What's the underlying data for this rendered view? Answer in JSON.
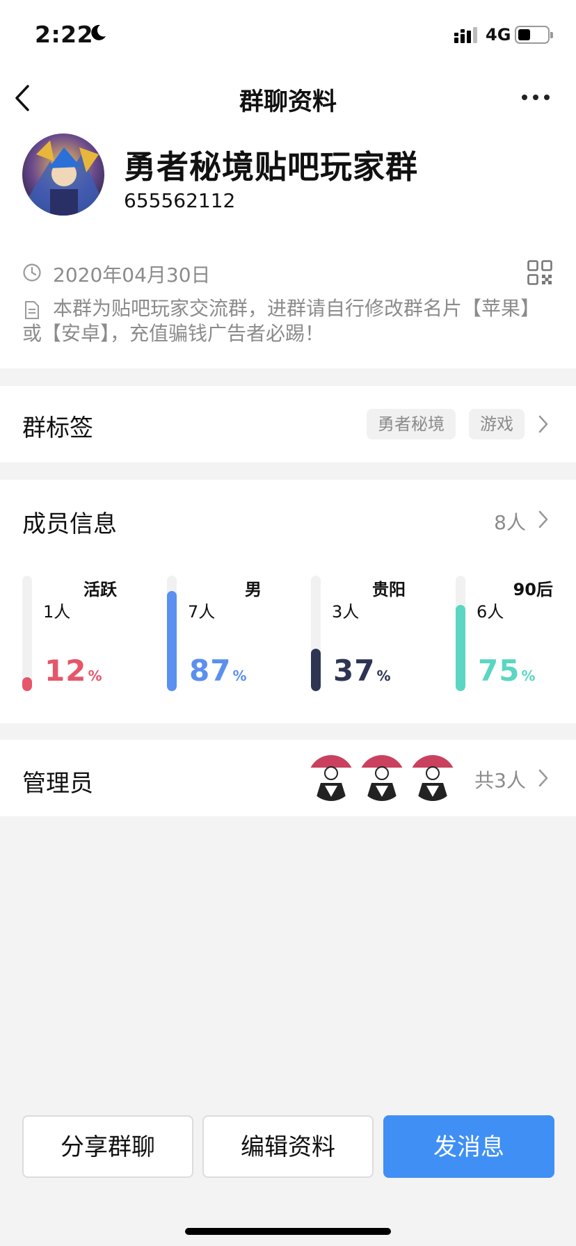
{
  "status_bar": {
    "time": "2:22",
    "network": "4G"
  },
  "nav": {
    "title": "群聊资料"
  },
  "group": {
    "name": "勇者秘境贴吧玩家群",
    "id": "655562112",
    "created_date": "2020年04月30日",
    "description": "本群为贴吧玩家交流群，进群请自行修改群名片【苹果】或【安卓】，充值骗钱广告者必踢！"
  },
  "tags_section": {
    "label": "群标签",
    "tags": [
      "勇者秘境",
      "游戏"
    ]
  },
  "members_section": {
    "label": "成员信息",
    "count": "8人",
    "stats": [
      {
        "title": "活跃",
        "sub": "1人",
        "value": "12",
        "unit": "%",
        "fill": 0.12,
        "color": "#e5566a"
      },
      {
        "title": "男",
        "sub": "7人",
        "value": "87",
        "unit": "%",
        "fill": 0.87,
        "color": "#5b8ff0"
      },
      {
        "title": "贵阳",
        "sub": "3人",
        "value": "37",
        "unit": "%",
        "fill": 0.37,
        "color": "#2d3552"
      },
      {
        "title": "90后",
        "sub": "6人",
        "value": "75",
        "unit": "%",
        "fill": 0.75,
        "color": "#5ad6c3"
      }
    ]
  },
  "admins_section": {
    "label": "管理员",
    "total": "共3人",
    "avatar_count": 3
  },
  "actions": {
    "share": "分享群聊",
    "edit": "编辑资料",
    "message": "发消息"
  },
  "colors": {
    "primary": "#3f8ff5",
    "muted_text": "#8b8b8b",
    "background": "#f3f3f3"
  }
}
